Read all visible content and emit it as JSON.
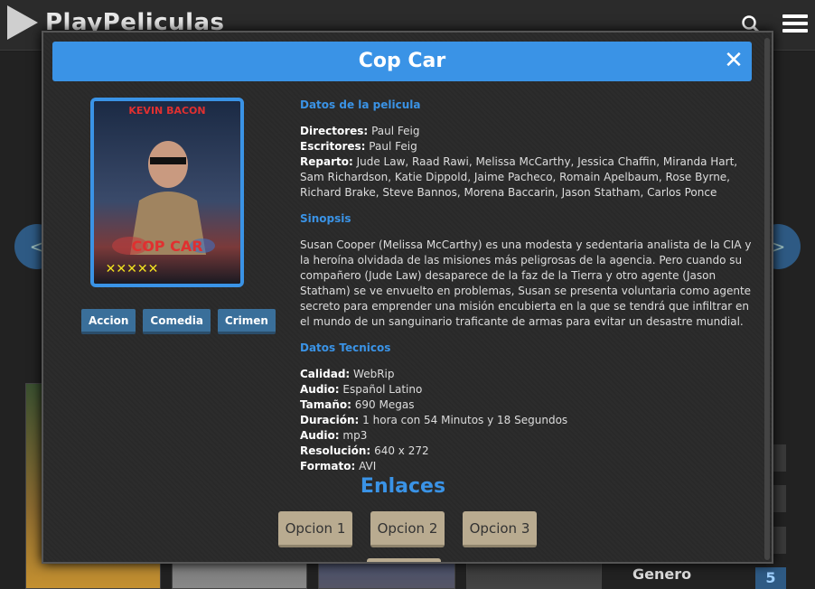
{
  "site": {
    "logo_text": "PlayPeliculas"
  },
  "background": {
    "genre_label": "Genero",
    "genre_count": "5"
  },
  "modal": {
    "title": "Cop Car",
    "close_label": "✕",
    "poster": {
      "actor_text": "KEVIN BACON",
      "title_text": "COP CAR",
      "rating_text": "✕✕✕✕✕"
    },
    "genres": [
      "Accion",
      "Comedia",
      "Crimen"
    ],
    "sections": {
      "details_title": "Datos de la pelicula",
      "synopsis_title": "Sinopsis",
      "tech_title": "Datos Tecnicos"
    },
    "details": {
      "directores_label": "Directores:",
      "directores": "Paul Feig",
      "escritores_label": "Escritores:",
      "escritores": "Paul Feig",
      "reparto_label": "Reparto:",
      "reparto": "Jude Law, Raad Rawi, Melissa McCarthy, Jessica Chaffin, Miranda Hart, Sam Richardson, Katie Dippold, Jaime Pacheco, Romain Apelbaum, Rose Byrne, Richard Brake, Steve Bannos, Morena Baccarin, Jason Statham, Carlos Ponce"
    },
    "synopsis": "Susan Cooper (Melissa McCarthy) es una modesta y sedentaria analista de la CIA y la heroína olvidada de las misiones más peligrosas de la agencia. Pero cuando su compañero (Jude Law) desaparece de la faz de la Tierra y otro agente (Jason Statham) se ve envuelto en problemas, Susan se presenta voluntaria como agente secreto para emprender una misión encubierta en la que se tendrá que infiltrar en el mundo de un sanguinario traficante de armas para evitar un desastre mundial.",
    "tech": [
      {
        "label": "Calidad:",
        "value": "WebRip"
      },
      {
        "label": "Audio:",
        "value": "Español Latino"
      },
      {
        "label": "Tamaño:",
        "value": "690 Megas"
      },
      {
        "label": "Duración:",
        "value": "1 hora con 54 Minutos y 18 Segundos"
      },
      {
        "label": "Audio:",
        "value": "mp3"
      },
      {
        "label": "Resolución:",
        "value": "640 x 272"
      },
      {
        "label": "Formato:",
        "value": "AVI"
      }
    ],
    "links_title": "Enlaces",
    "options": [
      "Opcion 1",
      "Opcion 2",
      "Opcion 3"
    ]
  },
  "colors": {
    "accent": "#3a93e6",
    "genre_button": "#3a6f9a",
    "option_button": "#b9ab90",
    "modal_bg": "#2a2a2a"
  },
  "icons": [
    "search-icon",
    "menu-icon",
    "close-icon",
    "chevron-left-icon",
    "chevron-right-icon"
  ]
}
